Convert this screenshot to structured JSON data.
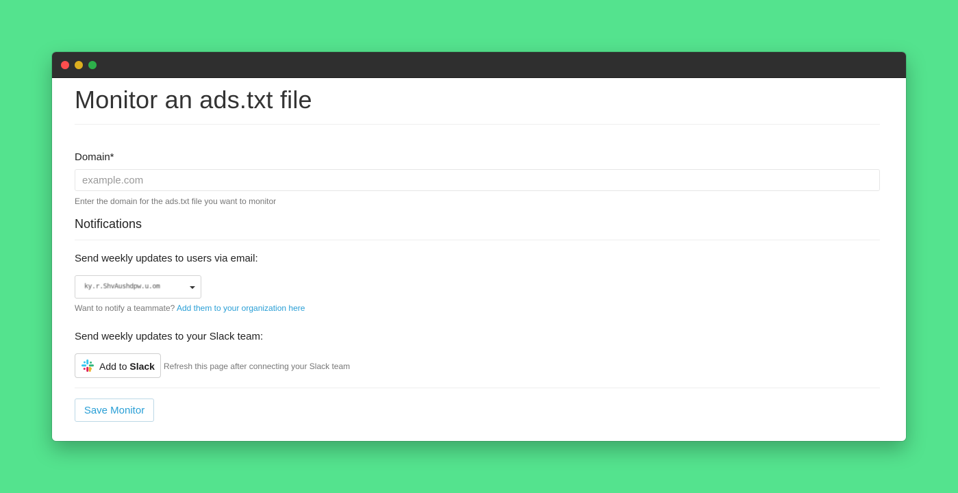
{
  "page": {
    "title": "Monitor an ads.txt file"
  },
  "domain": {
    "label": "Domain*",
    "placeholder": "example.com",
    "help": "Enter the domain for the ads.txt file you want to monitor"
  },
  "notifications": {
    "title": "Notifications",
    "email_label": "Send weekly updates to users via email:",
    "email_selected": "ky.r.ShvAushdpw.u.om",
    "teammate_text": "Want to notify a teammate? ",
    "teammate_link": "Add them to your organization here",
    "slack_label": "Send weekly updates to your Slack team:",
    "slack_button_prefix": "Add to ",
    "slack_button_brand": "Slack",
    "slack_help": "Refresh this page after connecting your Slack team"
  },
  "actions": {
    "save_label": "Save Monitor"
  },
  "colors": {
    "background": "#54e38e",
    "link": "#2a9fd6",
    "titlebar": "#2f2f2f"
  }
}
